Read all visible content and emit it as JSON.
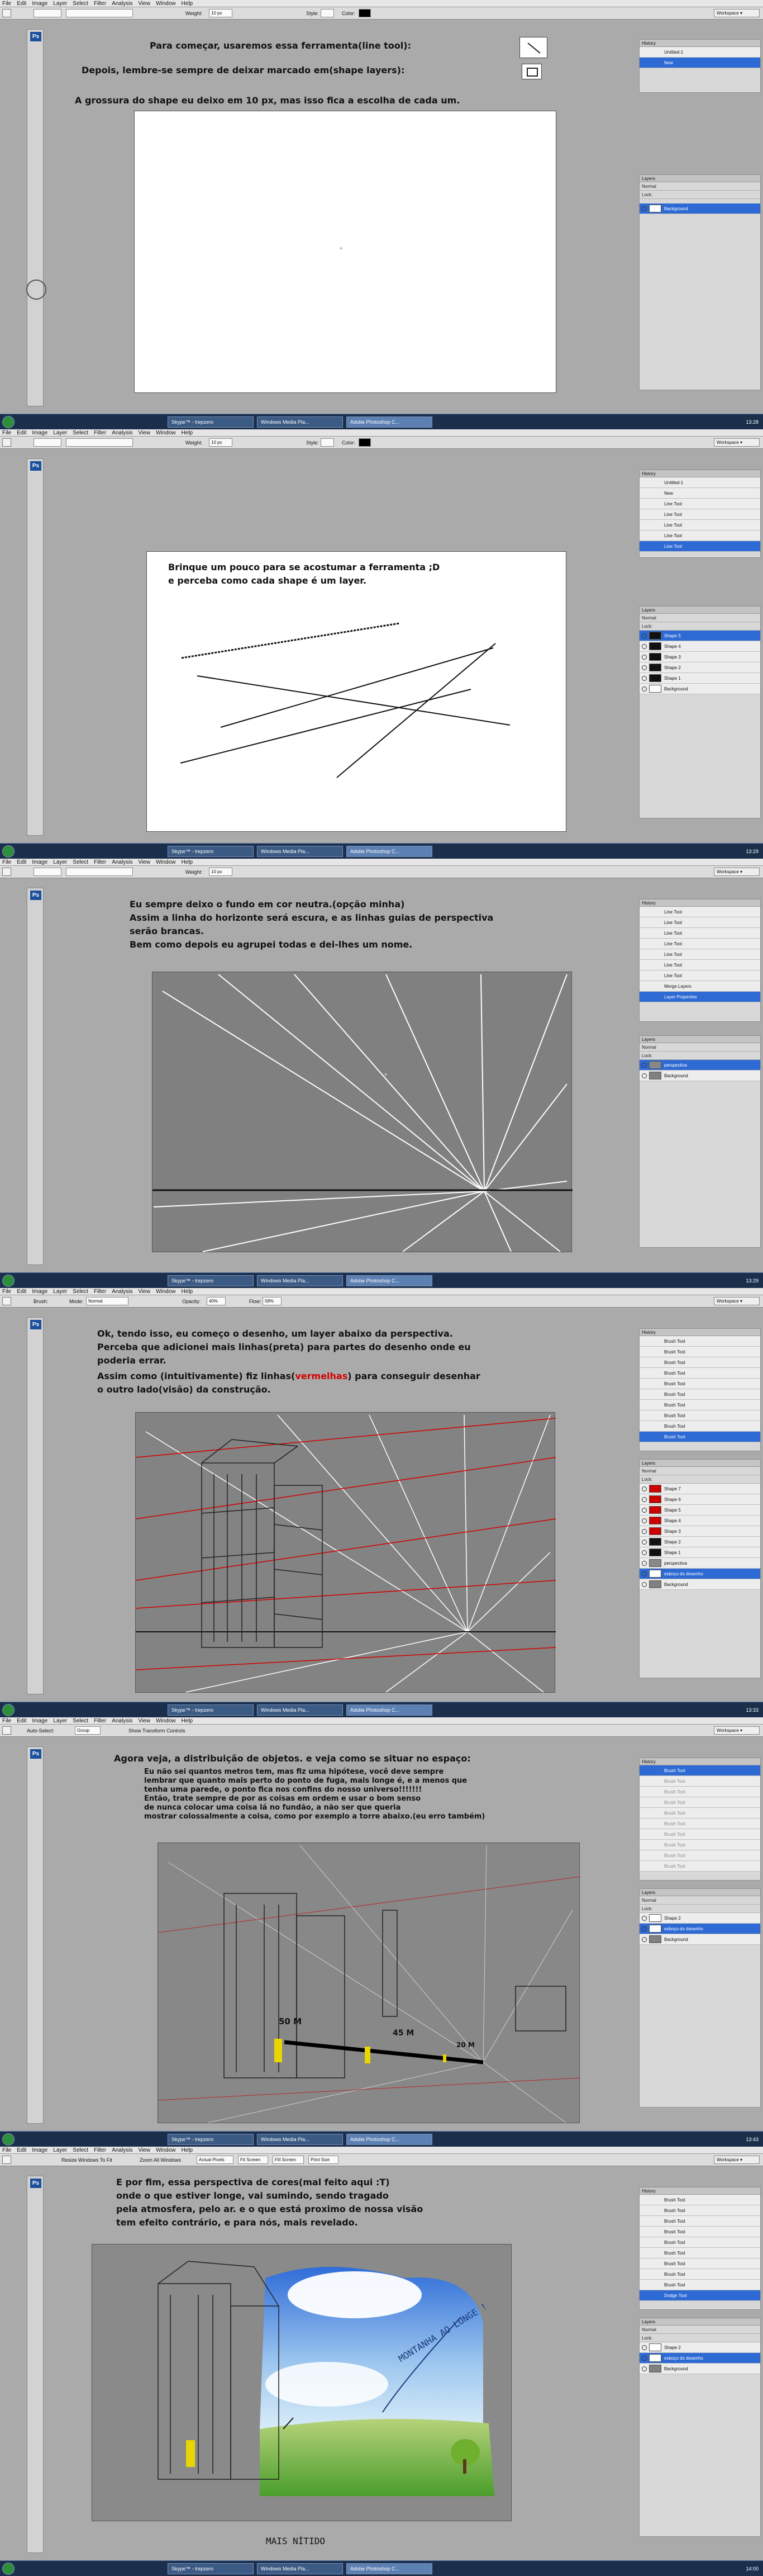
{
  "menu": [
    "File",
    "Edit",
    "Image",
    "Layer",
    "Select",
    "Filter",
    "Analysis",
    "View",
    "Window",
    "Help"
  ],
  "app_badge": "Ps",
  "workspace": "Workspace ▾",
  "opt": {
    "weight": "Weight:",
    "weight_val": "10 px",
    "style": "Style:",
    "color": "Color:",
    "mode": "Mode:",
    "mode_val": "Normal",
    "opacity": "Opacity:",
    "opacity_val": "40%",
    "flow": "Flow:",
    "flow_val": "58%",
    "brush": "Brush:",
    "autoselect": "Auto-Select:",
    "group": "Group",
    "show_transform": "Show Transform Controls",
    "resize": "Resize Windows To Fit",
    "zoom_all": "Zoom All Windows",
    "actual": "Actual Pixels",
    "fit": "Fit Screen",
    "fill": "Fill Screen",
    "print": "Print Size"
  },
  "panels": {
    "history": "History",
    "channels": "Channels",
    "paths": "Paths",
    "layers": "Layers",
    "normal": "Normal",
    "opacity": "Opacity:",
    "opacity_val": "100%",
    "lock": "Lock:",
    "fill": "Fill:",
    "fill_val": "100%"
  },
  "taskbar": {
    "skype": "Skype™ - trepzero",
    "wmp": "Windows Media Pla...",
    "ps": "Adobe Photoshop C..."
  },
  "clocks": [
    "13:28",
    "13:29",
    "13:29",
    "13:33",
    "13:43",
    "14:00"
  ],
  "s1": {
    "line1": "Para começar, usaremos essa ferramenta(line tool):",
    "line2": "Depois, lembre-se sempre de deixar marcado em(shape layers):",
    "line3": "A grossura do shape eu deixo em 10 px, mas isso fica a escolha de cada um.",
    "history": [
      "Untitled-1",
      "New"
    ],
    "layers": [
      "Background"
    ]
  },
  "s2": {
    "line1": "Brinque um pouco para se acostumar a ferramenta ;D",
    "line2": "e perceba como cada shape é um layer.",
    "history": [
      "Untitled-1",
      "New",
      "Line Tool",
      "Line Tool",
      "Line Tool",
      "Line Tool",
      "Line Tool"
    ],
    "layers": [
      "Shape 5",
      "Shape 4",
      "Shape 3",
      "Shape 2",
      "Shape 1",
      "Background"
    ]
  },
  "s3": {
    "line1": "Eu sempre deixo o fundo em cor neutra.(opção minha)",
    "line2": "Assim a linha do horizonte será escura, e as linhas guias de perspectiva",
    "line3": "serão brancas.",
    "line4": "Bem como depois eu agrupei todas e dei-lhes um nome.",
    "history": [
      "Line Tool",
      "Line Tool",
      "Line Tool",
      "Line Tool",
      "Line Tool",
      "Line Tool",
      "Line Tool",
      "Merge Layers",
      "Layer Properties"
    ],
    "layers": [
      "perspectiva",
      "Background"
    ]
  },
  "s4": {
    "line1": "Ok, tendo isso, eu começo o desenho, um layer abaixo da perspectiva.",
    "line2": "Perceba que adicionei mais linhas(preta) para partes do desenho onde eu",
    "line3": "poderia errar.",
    "line4a": "Assim como (intuitivamente) fiz linhas(",
    "line4b": "vermelhas",
    "line4c": ") para conseguir desenhar",
    "line5": "o outro lado(visão) da construção.",
    "history": [
      "Brush Tool",
      "Brush Tool",
      "Brush Tool",
      "Brush Tool",
      "Brush Tool",
      "Brush Tool",
      "Brush Tool",
      "Brush Tool",
      "Brush Tool",
      "Brush Tool"
    ],
    "layers": [
      "Shape 7",
      "Shape 6",
      "Shape 5",
      "Shape 4",
      "Shape 3",
      "Shape 2",
      "Shape 1",
      "perspectiva",
      "esboço do desenho",
      "Background"
    ]
  },
  "s5": {
    "line1": "Agora veja, a distribuição de objetos. e veja como se situar no espaço:",
    "line2": "Eu não sei quantos metros tem, mas fiz uma hipótese, você deve sempre",
    "line3": "lembrar que quanto mais perto do ponto de fuga, mais longe é, e a menos que",
    "line4": "tenha uma parede, o ponto fica nos confins do nosso universo!!!!!!!",
    "line5": "Então, trate sempre de por as coisas em ordem e usar o bom senso",
    "line6": "de nunca colocar uma coisa lá no fundão, a não ser que queria",
    "line7": "mostrar colossalmente a coisa, como por exemplo a torre abaixo.(eu erro também)",
    "marks": [
      "50 M",
      "45 M",
      "20 M"
    ],
    "history": [
      "Brush Tool",
      "Brush Tool",
      "Brush Tool",
      "Brush Tool",
      "Brush Tool",
      "Brush Tool",
      "Brush Tool",
      "Brush Tool",
      "Brush Tool",
      "Brush Tool"
    ],
    "layers": [
      "Shape 2",
      "esboço do desenho",
      "Background"
    ]
  },
  "s6": {
    "line1": "E por fim, essa perspectiva de cores(mal feito aqui :T)",
    "line2": "onde o que estiver longe, vai sumindo, sendo tragado",
    "line3": "pela atmosfera, pelo ar. e o que está proximo de nossa visão",
    "line4": "tem efeito contrário, e para nós, mais revelado.",
    "annot1": "MONTANHA AO LONGE !",
    "annot2": "MAIS NÍTIDO",
    "history": [
      "Brush Tool",
      "Brush Tool",
      "Brush Tool",
      "Brush Tool",
      "Brush Tool",
      "Brush Tool",
      "Brush Tool",
      "Brush Tool",
      "Brush Tool",
      "Dodge Tool"
    ],
    "layers": [
      "Shape 2",
      "esboço do desenho",
      "Background"
    ]
  }
}
